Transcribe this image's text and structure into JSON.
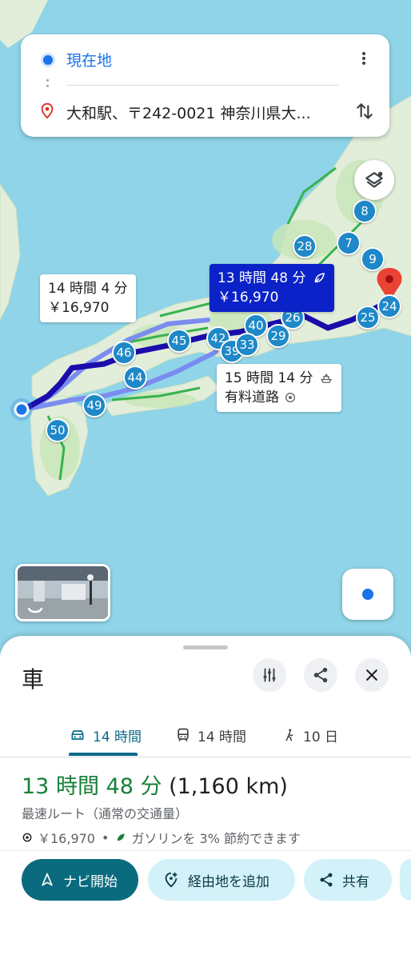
{
  "search": {
    "origin": "現在地",
    "destination": "大和駅、〒242-0021 神奈川県大..."
  },
  "map": {
    "route_labels": [
      {
        "time": "14 時間 4 分",
        "cost": "￥16,970",
        "selected": false
      },
      {
        "time": "13 時間 48 分",
        "cost": "￥16,970",
        "selected": true
      },
      {
        "time": "15 時間 14 分",
        "cost": "有料道路",
        "selected": false
      }
    ],
    "road_numbers": [
      "8",
      "28",
      "7",
      "9",
      "26",
      "25",
      "24",
      "45",
      "42",
      "40",
      "39",
      "33",
      "29",
      "46",
      "44",
      "49",
      "50"
    ]
  },
  "sheet": {
    "mode_title": "車",
    "tabs": [
      {
        "label": "14 時間",
        "icon": "car-icon",
        "active": true
      },
      {
        "label": "14 時間",
        "icon": "train-icon",
        "active": false
      },
      {
        "label": "10 日",
        "icon": "walk-icon",
        "active": false
      }
    ],
    "route": {
      "time": "13 時間 48 分",
      "distance": "(1,160 km)",
      "description": "最速ルート（通常の交通量）",
      "toll": "￥16,970",
      "separator": "•",
      "eco": "ガソリンを 3% 節約できます"
    },
    "actions": {
      "start": "ナビ開始",
      "add_stop": "経由地を追加",
      "share": "共有"
    }
  },
  "colors": {
    "accent": "#0b6b7e",
    "route_selected": "#1a0dab",
    "route_alt": "#7b8cf0",
    "time_green": "#188038",
    "water": "#8fd4e8",
    "land": "#e4efe0"
  }
}
